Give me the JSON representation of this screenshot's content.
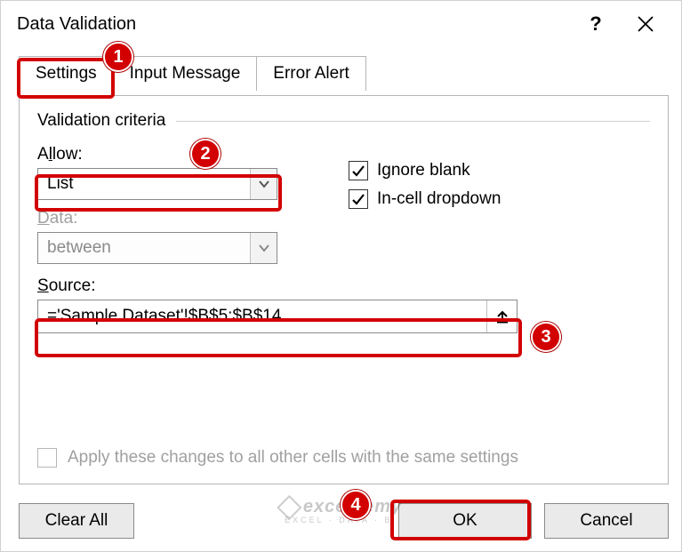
{
  "dialog": {
    "title": "Data Validation",
    "help_label": "?",
    "close_label": "Close"
  },
  "tabs": {
    "settings": "Settings",
    "input_message": "Input Message",
    "error_alert": "Error Alert"
  },
  "group": {
    "title": "Validation criteria"
  },
  "allow": {
    "label_pre": "A",
    "label_ul": "l",
    "label_post": "low:",
    "value": "List"
  },
  "data_field": {
    "label_pre": "",
    "label_ul": "D",
    "label_post": "ata:",
    "value": "between"
  },
  "checks": {
    "ignore_pre": "Ignore ",
    "ignore_ul": "b",
    "ignore_post": "lank",
    "ignore_checked": true,
    "incell_ul": "I",
    "incell_post": "n-cell dropdown",
    "incell_checked": true
  },
  "source": {
    "label_ul": "S",
    "label_post": "ource:",
    "value": "='Sample Dataset'!$B$5:$B$14"
  },
  "apply": {
    "label_pre": "Apply these changes to all other cells with the same settings",
    "label_ul": "",
    "checked": false
  },
  "buttons": {
    "clear_ul": "C",
    "clear_post": "lear All",
    "ok": "OK",
    "cancel": "Cancel"
  },
  "badges": {
    "b1": "1",
    "b2": "2",
    "b3": "3",
    "b4": "4"
  },
  "watermark": {
    "line1": "exceldemy",
    "line2": "EXCEL · DATA · BI"
  }
}
